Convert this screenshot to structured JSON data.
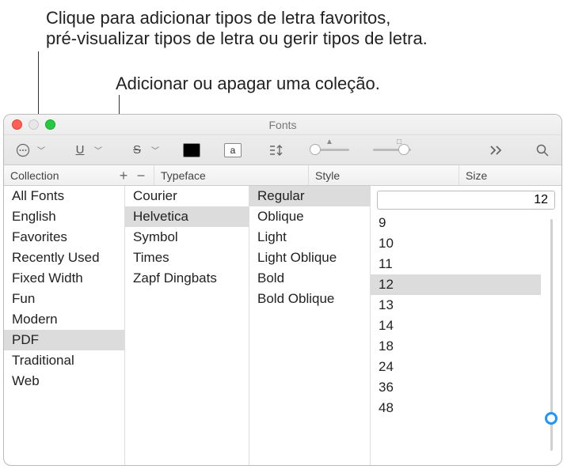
{
  "callouts": {
    "line1a": "Clique para adicionar tipos de letra favoritos,",
    "line1b": "pré-visualizar tipos de letra ou gerir tipos de letra.",
    "line2": "Adicionar ou apagar uma coleção."
  },
  "window": {
    "title": "Fonts"
  },
  "toolbar": {
    "more_icon": "more-icon",
    "underline_label": "U",
    "strike_label": "S",
    "doc_label": "a",
    "spacing_label": "⇵",
    "search_icon": "search-icon",
    "chevrons_icon": "chevrons-icon"
  },
  "headers": {
    "collection": "Collection",
    "typeface": "Typeface",
    "style": "Style",
    "size": "Size"
  },
  "collections": {
    "items": [
      {
        "label": "All Fonts"
      },
      {
        "label": "English"
      },
      {
        "label": "Favorites"
      },
      {
        "label": "Recently Used"
      },
      {
        "label": "Fixed Width"
      },
      {
        "label": "Fun"
      },
      {
        "label": "Modern"
      },
      {
        "label": "PDF"
      },
      {
        "label": "Traditional"
      },
      {
        "label": "Web"
      }
    ],
    "selected_index": 7
  },
  "typefaces": {
    "items": [
      {
        "label": "Courier"
      },
      {
        "label": "Helvetica"
      },
      {
        "label": "Symbol"
      },
      {
        "label": "Times"
      },
      {
        "label": "Zapf Dingbats"
      }
    ],
    "selected_index": 1
  },
  "styles": {
    "items": [
      {
        "label": "Regular"
      },
      {
        "label": "Oblique"
      },
      {
        "label": "Light"
      },
      {
        "label": "Light Oblique"
      },
      {
        "label": "Bold"
      },
      {
        "label": "Bold Oblique"
      }
    ],
    "selected_index": 0
  },
  "size": {
    "current": "12",
    "options": [
      {
        "label": "9"
      },
      {
        "label": "10"
      },
      {
        "label": "11"
      },
      {
        "label": "12"
      },
      {
        "label": "13"
      },
      {
        "label": "14"
      },
      {
        "label": "18"
      },
      {
        "label": "24"
      },
      {
        "label": "36"
      },
      {
        "label": "48"
      }
    ],
    "selected_index": 3
  }
}
